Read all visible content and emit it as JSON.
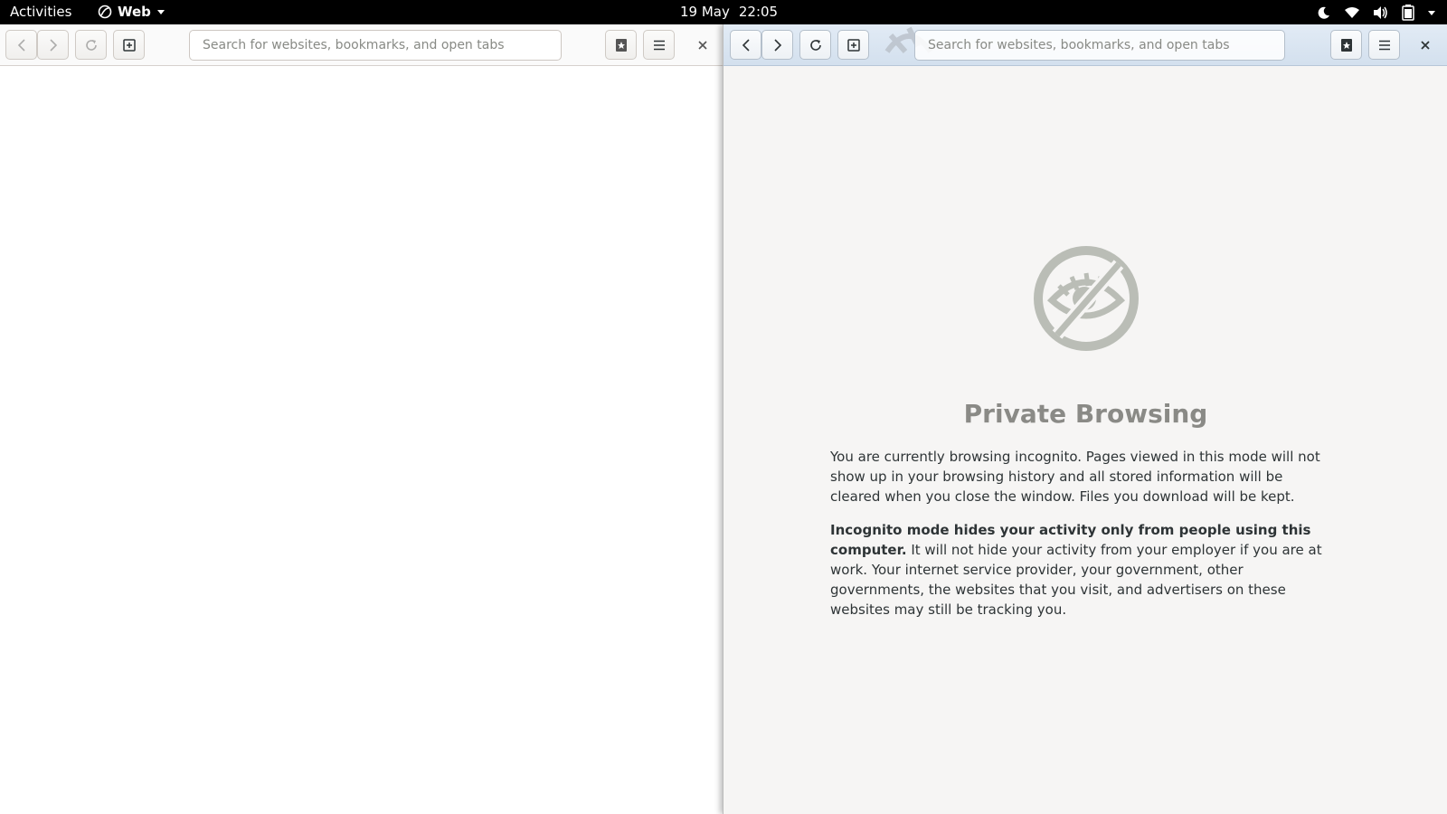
{
  "topbar": {
    "activities": "Activities",
    "app_name": "Web",
    "date": "19 May",
    "time": "22:05",
    "icons": [
      "night-light-icon",
      "wifi-icon",
      "volume-icon",
      "battery-icon",
      "system-menu-arrow-icon"
    ]
  },
  "left_window": {
    "url_placeholder": "Search for websites, bookmarks, and open tabs",
    "close_label": "×"
  },
  "right_window": {
    "url_placeholder": "Search for websites, bookmarks, and open tabs",
    "close_label": "×",
    "page": {
      "title": "Private Browsing",
      "paragraph1": "You are currently browsing incognito. Pages viewed in this mode will not show up in your browsing history and all stored information will be cleared when you close the window. Files you download will be kept.",
      "paragraph2_bold": "Incognito mode hides your activity only from people using this computer.",
      "paragraph2_rest": " It will not hide your activity from your employer if you are at work. Your internet service provider, your government, other governments, the websites that you visit, and advertisers on these websites may still be tracking you."
    }
  },
  "colors": {
    "topbar_bg": "#000000",
    "incognito_headerbar": "#d3e0ee",
    "private_icon": "#babdb6",
    "page_bg": "#f6f5f4"
  }
}
